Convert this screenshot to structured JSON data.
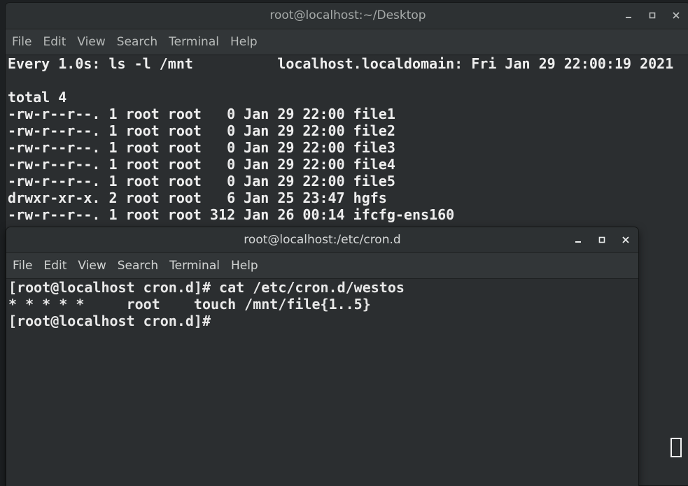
{
  "back_window": {
    "title": "root@localhost:~/Desktop",
    "controls": {
      "minimize": "_",
      "maximize": "□",
      "close": "×"
    },
    "menu": [
      "File",
      "Edit",
      "View",
      "Search",
      "Terminal",
      "Help"
    ],
    "lines": [
      "Every 1.0s: ls -l /mnt          localhost.localdomain: Fri Jan 29 22:00:19 2021",
      "",
      "total 4",
      "-rw-r--r--. 1 root root   0 Jan 29 22:00 file1",
      "-rw-r--r--. 1 root root   0 Jan 29 22:00 file2",
      "-rw-r--r--. 1 root root   0 Jan 29 22:00 file3",
      "-rw-r--r--. 1 root root   0 Jan 29 22:00 file4",
      "-rw-r--r--. 1 root root   0 Jan 29 22:00 file5",
      "drwxr-xr-x. 2 root root   6 Jan 25 23:47 hgfs",
      "-rw-r--r--. 1 root root 312 Jan 26 00:14 ifcfg-ens160"
    ]
  },
  "front_window": {
    "title": "root@localhost:/etc/cron.d",
    "controls": {
      "minimize": "_",
      "maximize": "□",
      "close": "×"
    },
    "menu": [
      "File",
      "Edit",
      "View",
      "Search",
      "Terminal",
      "Help"
    ],
    "lines": [
      "[root@localhost cron.d]# cat /etc/cron.d/westos",
      "* * * * *     root    touch /mnt/file{1..5}",
      "[root@localhost cron.d]#"
    ]
  }
}
